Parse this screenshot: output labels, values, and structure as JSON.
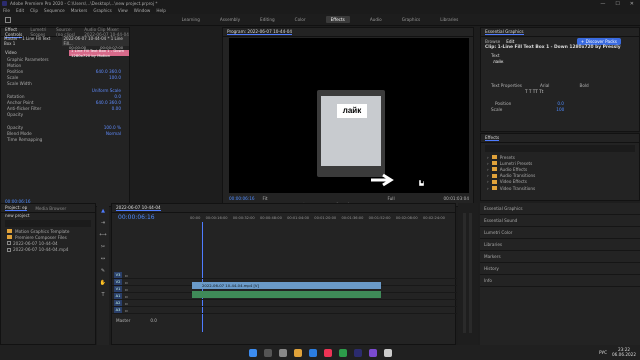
{
  "window": {
    "title": "Adobe Premiere Pro 2020 - C:\\Users\\...\\Desktop\\...\\new project.prproj *",
    "min": "—",
    "max": "☐",
    "close": "✕"
  },
  "menu": [
    "File",
    "Edit",
    "Clip",
    "Sequence",
    "Markers",
    "Graphics",
    "View",
    "Window",
    "Help"
  ],
  "workspaces": [
    "Learning",
    "Assembly",
    "Editing",
    "Color",
    "Effects",
    "Audio",
    "Graphics",
    "Libraries"
  ],
  "active_workspace": "Effects",
  "effect_controls": {
    "tabs": [
      "Effect Controls",
      "Lumetri Scopes",
      "Source: (no clips)",
      "Audio Clip Mixer: 2022-06-07 10-44-04"
    ],
    "master": "Master * 1 Line Fill Text Box 1",
    "clip": "2022-06-07 10-44-04 * 1 Line Fill...",
    "timecode": "00:00:00",
    "timecode2": "00:00:07:00",
    "clip_bar": "1 Line Fill Text Box 1 - Down 1280x720 by Motion",
    "video_label": "Video",
    "rows": [
      {
        "name": "Graphic Parameters",
        "val": ""
      },
      {
        "name": "Motion",
        "val": ""
      },
      {
        "name": "Position",
        "val": "640.0  360.0"
      },
      {
        "name": "Scale",
        "val": "100.0"
      },
      {
        "name": "Scale Width",
        "val": ""
      },
      {
        "name": "",
        "val": "Uniform Scale"
      },
      {
        "name": "Rotation",
        "val": "0.0"
      },
      {
        "name": "Anchor Point",
        "val": "640.0  360.0"
      },
      {
        "name": "Anti-flicker Filter",
        "val": "0.00"
      },
      {
        "name": "Opacity",
        "val": ""
      },
      {
        "name": "",
        "val": ""
      },
      {
        "name": "Opacity",
        "val": "100.0 %"
      },
      {
        "name": "Blend Mode",
        "val": "Normal"
      },
      {
        "name": "Time Remapping",
        "val": ""
      }
    ],
    "bottom_time": "00:00:06:16"
  },
  "program": {
    "title": "Program: 2022-06-07 10-44-04",
    "overlay_text": "лайк",
    "timecode_left": "00:00:06:16",
    "fit": "Fit",
    "full": "Full",
    "timecode_right": "00:01:03:04"
  },
  "essential": {
    "title": "Essential Graphics",
    "tabs": [
      "Browse",
      "Edit"
    ],
    "clip": "Clip: 1-Line Fill Text Box 1 - Down 1280x720 by Pressly",
    "discover": "+ Discover Packs",
    "text_header": "Text",
    "text_value": "лайк",
    "text_properties": "Text Properties",
    "font": "Arial",
    "style": "Bold",
    "position_label": "Position",
    "position_val": "0.0",
    "scale_label": "Scale",
    "scale_val": "100"
  },
  "effects": {
    "title": "Effects",
    "items": [
      "Presets",
      "Lumetri Presets",
      "Audio Effects",
      "Audio Transitions",
      "Video Effects",
      "Video Transitions"
    ]
  },
  "side_sections": [
    "Essential Graphics",
    "Essential Sound",
    "Lumetri Color",
    "Libraries",
    "Markers",
    "History",
    "Info"
  ],
  "project": {
    "tabs": [
      "Project: ep",
      "Media Browser"
    ],
    "name": "new project",
    "items": [
      {
        "name": "Motion Graphics Template"
      },
      {
        "name": "Premiere Composer Files"
      },
      {
        "name": "2022-06-07 10-44-04"
      },
      {
        "name": "2022-06-07 10-44-04.mp4"
      }
    ]
  },
  "timeline": {
    "title": "2022-06-07 10-44-04",
    "timecode": "00:00:06:16",
    "ruler": [
      "00:00",
      "00:00:16:00",
      "00:00:32:00",
      "00:00:48:00",
      "00:01:04:00",
      "00:01:20:00",
      "00:01:36:00",
      "00:01:52:00",
      "00:02:08:00",
      "00:02:24:00"
    ],
    "tracks": [
      "V3",
      "V2",
      "V1",
      "A1",
      "A2",
      "A3"
    ],
    "clip_v": "2022-06-07 10-44-04.mp4 [V]",
    "clip_a": "",
    "master": "Master",
    "master_val": "0.0"
  },
  "tray": {
    "lang": "РУС",
    "time": "23:22",
    "date": "06.06.2022"
  },
  "colors": {
    "accent": "#4f7cff",
    "clip_pink": "#d76a8a",
    "clip_blue": "#6a9ac8",
    "audio_green": "#3f8a58"
  }
}
